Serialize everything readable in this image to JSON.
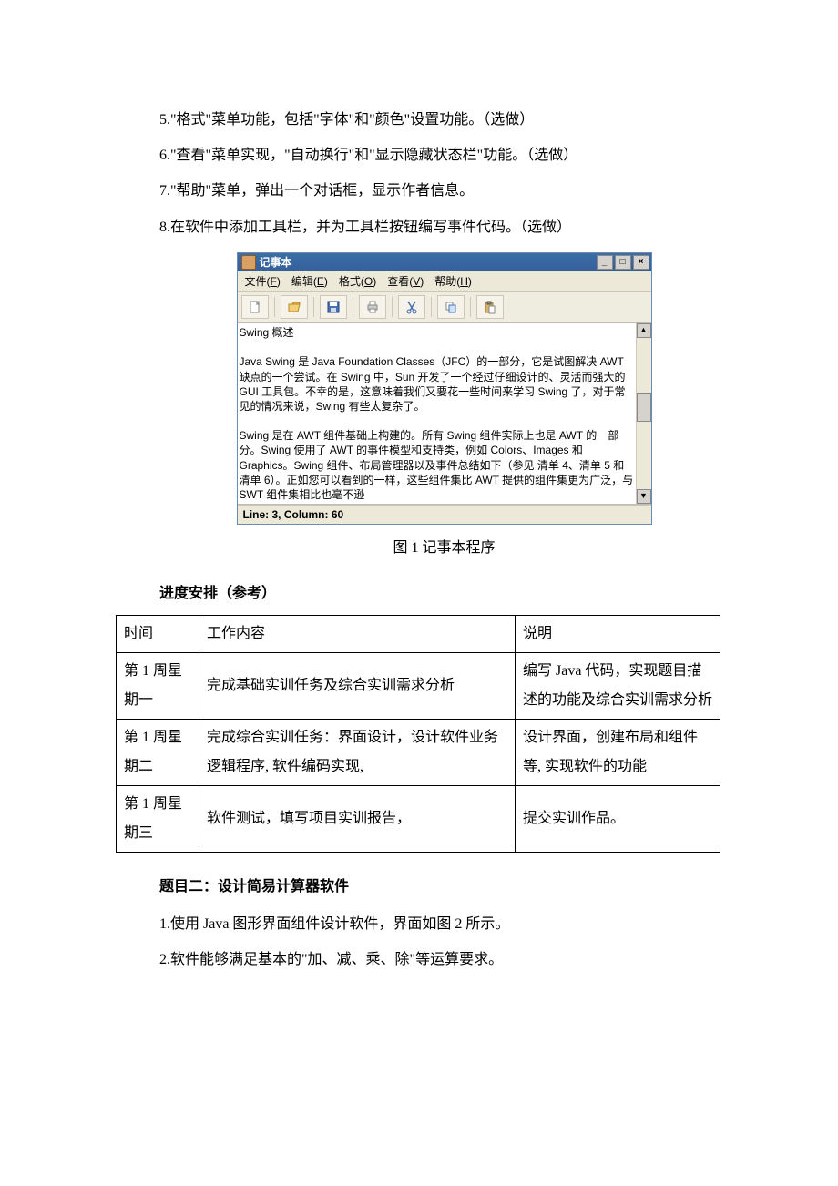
{
  "paragraphs": {
    "p5": "5.\"格式\"菜单功能，包括\"字体\"和\"颜色\"设置功能。（选做）",
    "p6": "6.\"查看\"菜单实现，\"自动换行\"和\"显示隐藏状态栏\"功能。（选做）",
    "p7": "7.\"帮助\"菜单，弹出一个对话框，显示作者信息。",
    "p8": "8.在软件中添加工具栏，并为工具栏按钮编写事件代码。（选做）"
  },
  "notepad": {
    "title": "记事本",
    "menu": {
      "file": "文件(F)",
      "edit": "编辑(E)",
      "format": "格式(O)",
      "view": "查看(V)",
      "help": "帮助(H)"
    },
    "text_heading": "Swing 概述",
    "text_p1": "Java Swing 是 Java Foundation Classes（JFC）的一部分，它是试图解决 AWT 缺点的一个尝试。在 Swing 中，Sun 开发了一个经过仔细设计的、灵活而强大的 GUI 工具包。不幸的是，这意味着我们又要花一些时间来学习 Swing 了，对于常见的情况来说，Swing 有些太复杂了。",
    "text_p2": "Swing 是在 AWT 组件基础上构建的。所有 Swing 组件实际上也是 AWT 的一部分。Swing 使用了 AWT 的事件模型和支持类，例如 Colors、Images 和 Graphics。Swing 组件、布局管理器以及事件总结如下（参见 清单 4、清单 5 和 清单 6）。正如您可以看到的一样，这些组件集比 AWT 提供的组件集更为广泛，与 SWT 组件集相比也毫不逊",
    "status": "Line: 3, Column: 60"
  },
  "figure_caption": "图 1  记事本程序",
  "schedule": {
    "heading": "进度安排（参考）",
    "headers": {
      "time": "时间",
      "work": "工作内容",
      "note": "说明"
    },
    "rows": [
      {
        "time": "第 1 周星期一",
        "work": "完成基础实训任务及综合实训需求分析",
        "note": "编写 Java 代码，实现题目描述的功能及综合实训需求分析"
      },
      {
        "time": "第 1 周星期二",
        "work": "完成综合实训任务：界面设计，设计软件业务逻辑程序, 软件编码实现,",
        "note": "设计界面，创建布局和组件等, 实现软件的功能"
      },
      {
        "time": "第 1 周星期三",
        "work": "软件测试，填写项目实训报告，",
        "note": "提交实训作品。"
      }
    ]
  },
  "topic2": {
    "heading": "题目二：设计简易计算器软件",
    "p1": "1.使用 Java 图形界面组件设计软件，界面如图 2 所示。",
    "p2": "2.软件能够满足基本的\"加、减、乘、除\"等运算要求。"
  }
}
